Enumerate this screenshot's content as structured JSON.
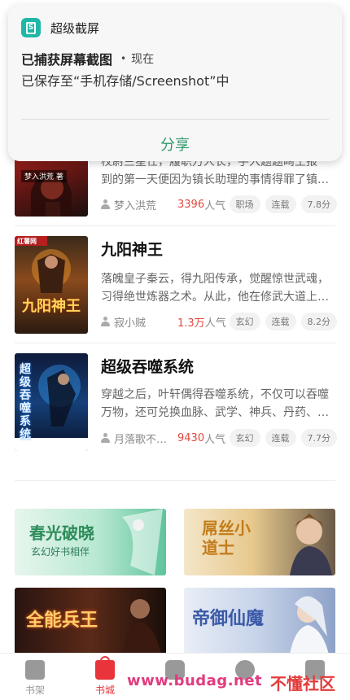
{
  "notification": {
    "app_name": "超级截屏",
    "title": "已捕获屏幕截图",
    "time": "现在",
    "body": "已保存至“手机存储/Screenshot”中",
    "action": "分享"
  },
  "books": [
    {
      "title": "",
      "cover_text": "梦入洪荒 著",
      "desc": "",
      "desc_visible_1": "校尉兰星任，履职万人长，手入题题畸王报",
      "desc_visible_2": "到的第一天便因为镇长助理的事情得罪了镇…",
      "author": "梦入洪荒",
      "popularity_num": "3396",
      "popularity_unit": "人气",
      "tags": [
        "职场",
        "连载",
        "7.8分"
      ]
    },
    {
      "title": "九阳神王",
      "cover_text": "九阳神王",
      "desc_line1": "落魄皇子秦云，得九阳传承，觉醒惊世武魂，",
      "desc_line2": "习得绝世炼器之术。从此，他在修武大道上…",
      "author": "寂小贼",
      "popularity_num": "1.3万",
      "popularity_unit": "人气",
      "tags": [
        "玄幻",
        "连载",
        "8.2分"
      ]
    },
    {
      "title": "超级吞噬系统",
      "cover_text": "超级吞噬系统",
      "desc_line1": "穿越之后，叶轩偶得吞噬系统，不仅可以吞噬",
      "desc_line2": "万物，还可兑换血脉、武学、神兵、丹药、…",
      "author": "月落歌不…",
      "popularity_num": "9430",
      "popularity_unit": "人气",
      "tags": [
        "玄幻",
        "连载",
        "7.7分"
      ]
    }
  ],
  "banners": [
    {
      "title": "春光破晓",
      "sub": "玄幻好书相伴"
    },
    {
      "title": "屌丝小道士",
      "sub": ""
    },
    {
      "title": "全能兵王",
      "sub": ""
    },
    {
      "title": "帝御仙魔",
      "sub": ""
    }
  ],
  "bottom_nav": {
    "items": [
      {
        "label": "书架",
        "active": false
      },
      {
        "label": "书城",
        "active": true
      },
      {
        "label": "",
        "active": false
      },
      {
        "label": "",
        "active": false
      },
      {
        "label": "",
        "active": false
      }
    ]
  },
  "watermark": {
    "url": "www.budag.net",
    "site": "不懂社区"
  },
  "colors": {
    "accent_red": "#e8343a",
    "popularity_red": "#e0493f",
    "share_green": "#2f9a6b",
    "app_icon": "#1fb8a6"
  }
}
